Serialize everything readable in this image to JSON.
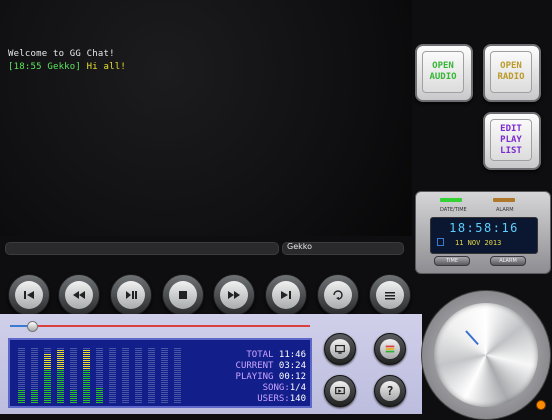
{
  "chat": {
    "lines": [
      {
        "text": "Welcome to GG Chat!"
      },
      {
        "prefix": "[18:55 Gekko]",
        "message": "Hi all!"
      }
    ],
    "nickname": "Gekko"
  },
  "side_buttons": {
    "open_audio": "OPEN\nAUDIO",
    "open_radio": "OPEN\nRADIO",
    "edit_playlist": "EDIT\nPLAY\nLIST"
  },
  "clock": {
    "date_time_label": "DATE/TIME",
    "alarm_label": "ALARM",
    "time": "18:58:16",
    "date": "11 NOV 2013",
    "time_button": "TIME",
    "alarm_button": "ALARM",
    "led_time_color": "#34d234",
    "led_alarm_color": "#b0782a"
  },
  "transport": [
    {
      "name": "previous",
      "icon": "skip-back-icon"
    },
    {
      "name": "rewind",
      "icon": "rewind-icon"
    },
    {
      "name": "play-pause",
      "icon": "play-pause-icon"
    },
    {
      "name": "stop",
      "icon": "stop-icon"
    },
    {
      "name": "fast-forward",
      "icon": "fast-forward-icon"
    },
    {
      "name": "next",
      "icon": "skip-next-icon"
    },
    {
      "name": "loop",
      "icon": "loop-icon"
    },
    {
      "name": "options",
      "icon": "options-icon"
    }
  ],
  "seek": {
    "position": 0.06
  },
  "stats": {
    "total_label": "TOTAL",
    "total": "11:46",
    "current_label": "CURRENT",
    "current": "03:24",
    "playing_label": "PLAYING",
    "playing": "00:12",
    "song_label": "SONG:",
    "song": "1/4",
    "users_label": "USERS:",
    "users": "140"
  },
  "vu_levels": [
    0.25,
    0.25,
    0.9,
    0.95,
    0.25,
    0.95,
    0.3,
    0.0,
    0.0,
    0.0,
    0.0,
    0.0,
    0.0
  ],
  "colors": {
    "panel": "#121e8a",
    "vu_green": "#2bc12b",
    "vu_yellow": "#e6e02a",
    "vu_off": "#4a56a8",
    "stats_label": "#c9a4ff"
  }
}
